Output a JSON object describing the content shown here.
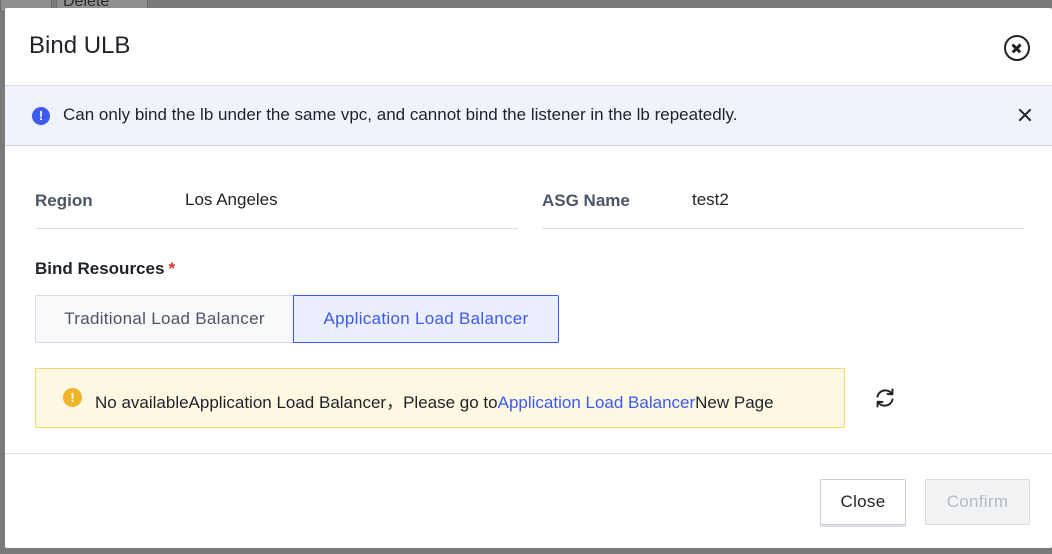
{
  "background": {
    "delete_label": "Delete"
  },
  "modal": {
    "title": "Bind ULB",
    "notice": "Can only bind the lb under the same vpc, and cannot bind the listener in the lb repeatedly.",
    "region_label": "Region",
    "region_value": "Los Angeles",
    "asg_label": "ASG Name",
    "asg_value": "test2",
    "bind_label": "Bind Resources",
    "required_mark": "*",
    "tabs": [
      "Traditional Load Balancer",
      "Application Load Balancer"
    ],
    "selected_tab": "Application Load Balancer",
    "warning": {
      "prefix": "No availableApplication Load Balancer，Please go to",
      "link": "Application Load Balancer",
      "suffix": "New Page"
    },
    "close_button": "Close",
    "confirm_button": "Confirm"
  },
  "colors": {
    "accent": "#3d5af1",
    "warning_bg": "#fdf8e1",
    "warning_icon": "#f0b429",
    "required": "#e0302c"
  }
}
